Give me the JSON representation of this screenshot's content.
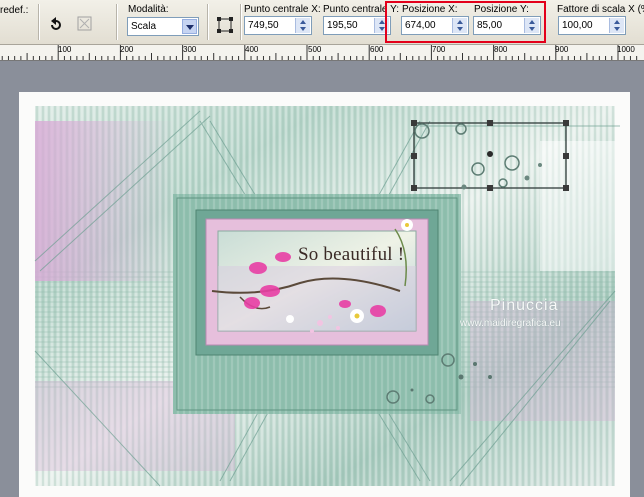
{
  "toolbar": {
    "preset_label": "redef.:",
    "mode_label": "Modalità:",
    "mode_value": "Scala",
    "center_x_label": "Punto centrale X:",
    "center_x_value": "749,50",
    "center_y_label": "Punto centrale Y:",
    "center_y_value": "195,50",
    "pos_x_label": "Posizione X:",
    "pos_x_value": "674,00",
    "pos_y_label": "Posizione Y:",
    "pos_y_value": "85,00",
    "scale_label": "Fattore di scala X (%",
    "scale_value": "100,00"
  },
  "ruler": {
    "marks": [
      "100",
      "200",
      "300",
      "400",
      "500",
      "600",
      "700",
      "800",
      "900",
      "1000"
    ]
  },
  "canvas": {
    "headline": "So beautiful !",
    "watermark_name": "Pinuccia",
    "watermark_url": "www.maidiregrafica.eu"
  },
  "colors": {
    "highlight": "#e3001b",
    "frame_green": "#7fb8a6",
    "frame_pink": "#e6bfdc",
    "flower_pink": "#e83fa5"
  }
}
